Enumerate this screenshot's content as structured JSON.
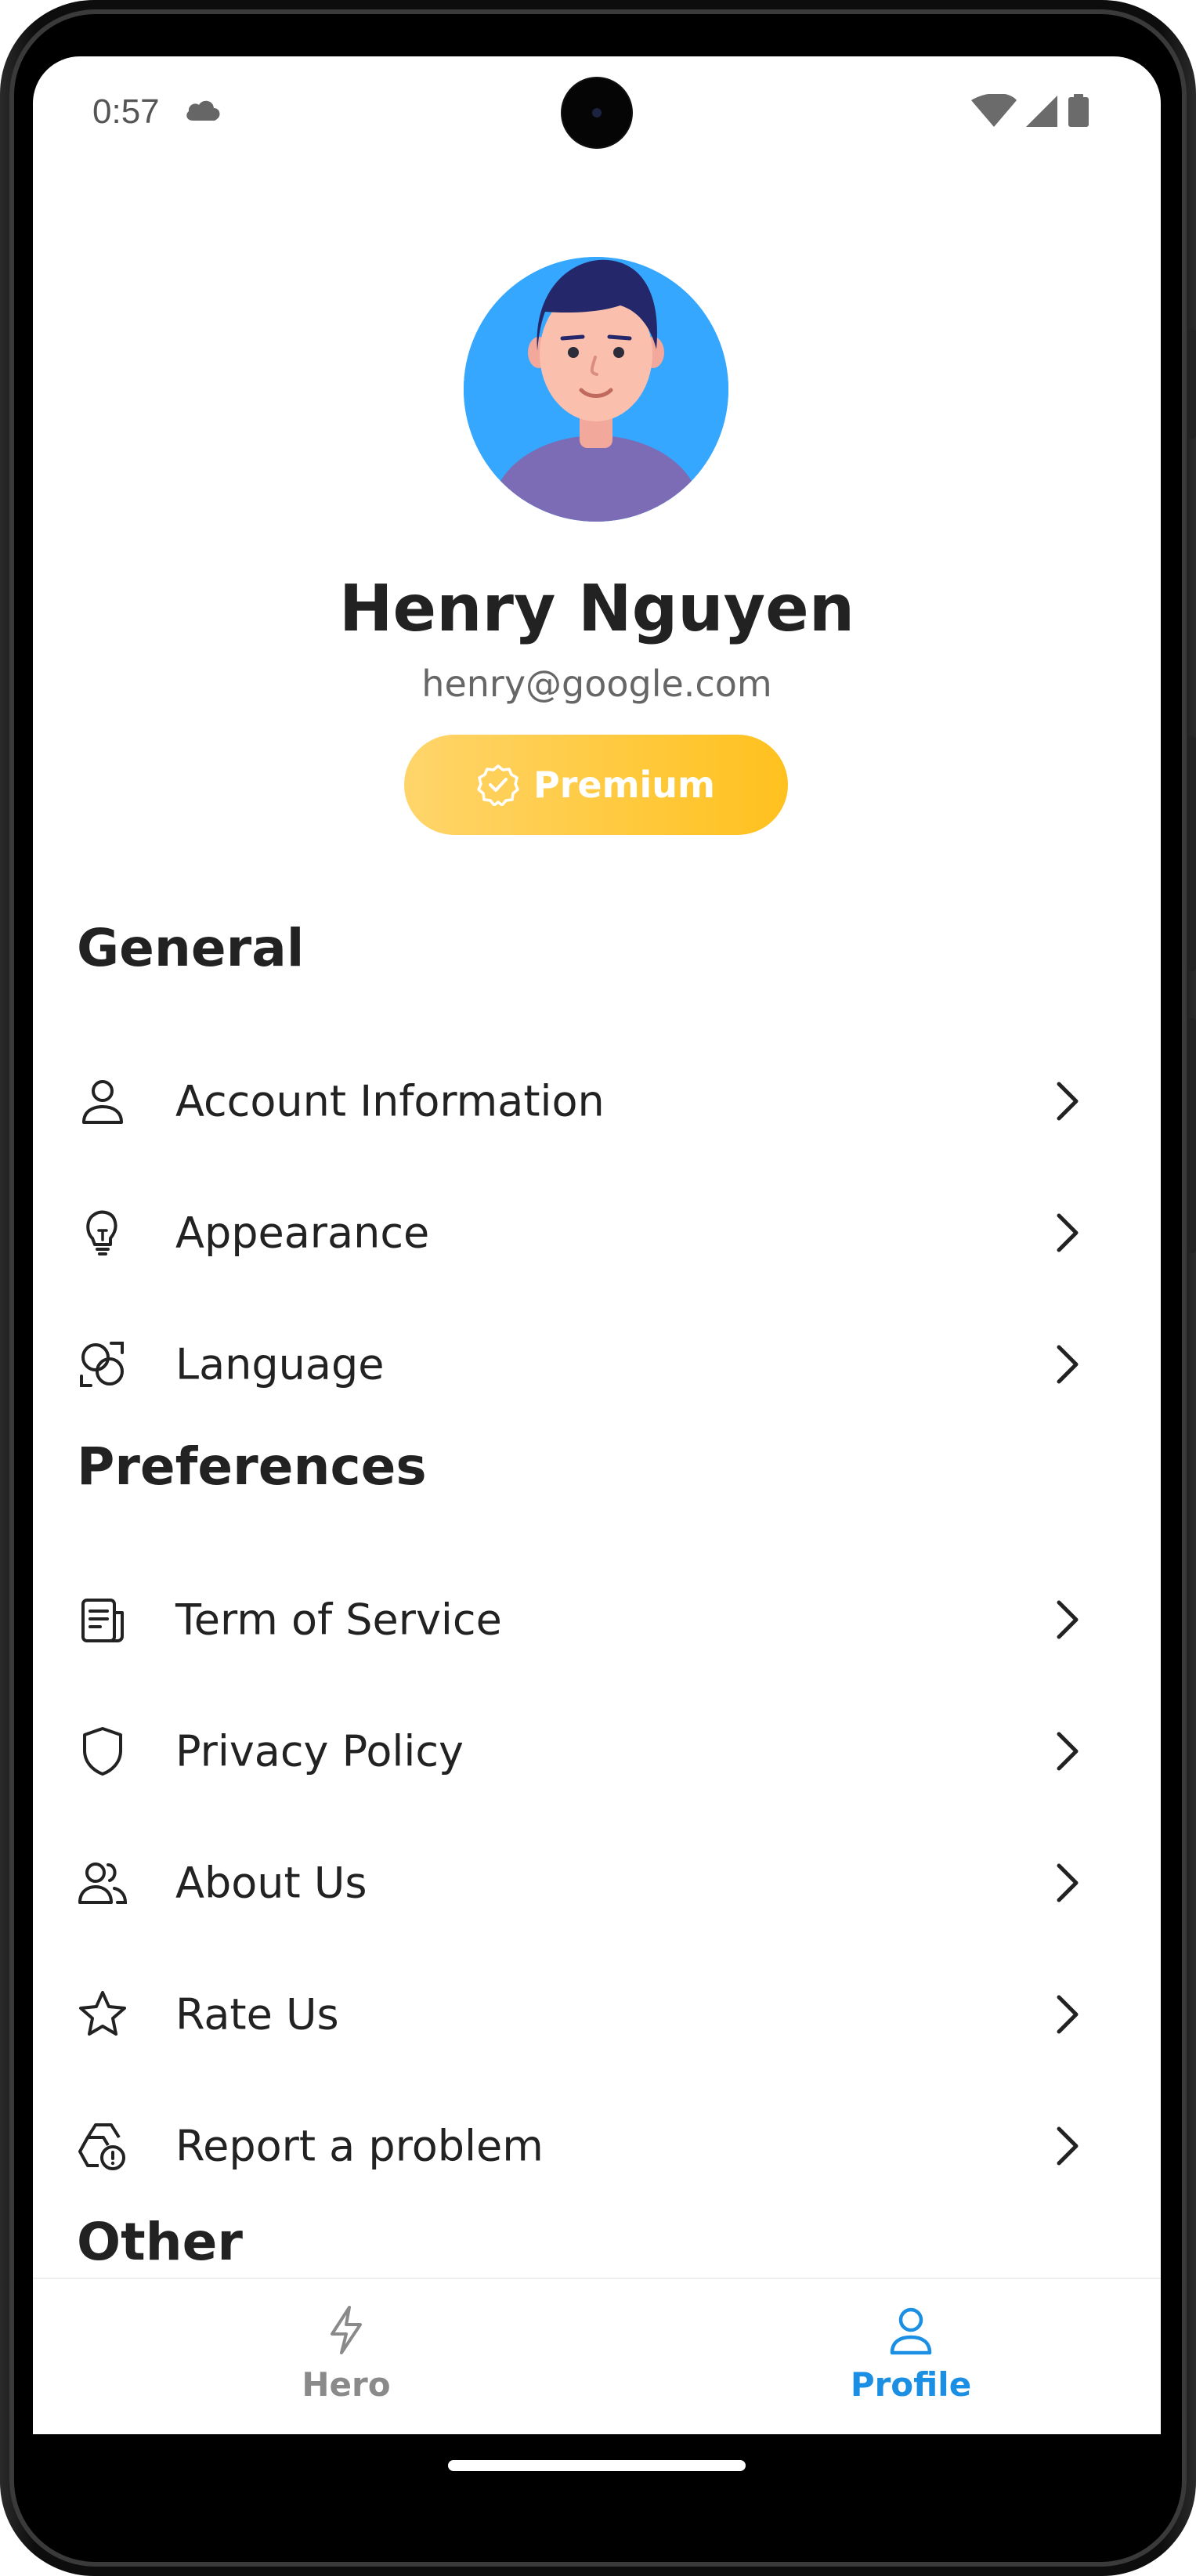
{
  "status_bar": {
    "time": "0:57",
    "icons": [
      "cloud-icon",
      "wifi-icon",
      "signal-icon",
      "battery-icon"
    ]
  },
  "profile": {
    "name": "Henry Nguyen",
    "email": "henry@google.com",
    "badge": {
      "label": "Premium",
      "icon": "verified-badge-icon"
    }
  },
  "sections": {
    "general": {
      "title": "General",
      "items": [
        {
          "label": "Account Information",
          "icon": "user-icon"
        },
        {
          "label": "Appearance",
          "icon": "lightbulb-icon"
        },
        {
          "label": "Language",
          "icon": "language-icon"
        }
      ]
    },
    "preferences": {
      "title": "Preferences",
      "items": [
        {
          "label": "Term of Service",
          "icon": "document-icon"
        },
        {
          "label": "Privacy Policy",
          "icon": "shield-icon"
        },
        {
          "label": "About Us",
          "icon": "users-icon"
        },
        {
          "label": "Rate Us",
          "icon": "star-icon"
        },
        {
          "label": "Report a problem",
          "icon": "report-problem-icon"
        }
      ]
    },
    "other": {
      "title": "Other"
    }
  },
  "bottom_nav": {
    "items": [
      {
        "label": "Hero",
        "icon": "lightning-icon",
        "active": false
      },
      {
        "label": "Profile",
        "icon": "profile-icon",
        "active": true
      }
    ]
  },
  "colors": {
    "accent": "#1a8fe3",
    "premium_start": "#ffd56b",
    "premium_end": "#ffc11e",
    "text_primary": "#222222",
    "text_secondary": "#666666",
    "inactive_nav": "#8a8a8a"
  }
}
